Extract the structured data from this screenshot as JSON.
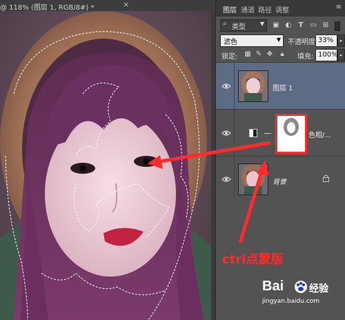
{
  "document": {
    "tab_title": "@ 118% (图层 1, RGB/8#) *",
    "close_glyph": "×"
  },
  "panel": {
    "tabs": [
      "图层",
      "通道",
      "路径",
      "调整"
    ],
    "menu_glyph": "≡",
    "filter": {
      "kind_label": "类型",
      "search_glyph": "⌕",
      "icons": [
        "image-filter-icon",
        "adjustment-filter-icon",
        "type-filter-icon",
        "shape-filter-icon",
        "smart-object-filter-icon"
      ]
    },
    "blend_mode": "滤色",
    "opacity_label": "不透明度:",
    "opacity_value": "33%",
    "lock_label": "锁定:",
    "lock_icons": [
      "lock-transparent-icon",
      "lock-brush-icon",
      "lock-move-icon",
      "lock-all-icon"
    ],
    "fill_label": "填充:",
    "fill_value": "100%",
    "layers": [
      {
        "name": "图层 1",
        "selected": true,
        "visible": true
      },
      {
        "name": "色相/...",
        "selected": false,
        "visible": true,
        "adjustment": true
      },
      {
        "name": "背景",
        "selected": false,
        "visible": true,
        "locked": true
      }
    ]
  },
  "annotation": {
    "text": "ctrl点蒙版",
    "color": "#ff2a2a"
  },
  "watermark": {
    "logo_text": "Bai",
    "brand": "经验",
    "url": "jingyan.baidu.com"
  },
  "colors": {
    "selected_layer": "#5d6b84",
    "panel_bg": "#535353",
    "arrow": "#ff2a2a"
  }
}
